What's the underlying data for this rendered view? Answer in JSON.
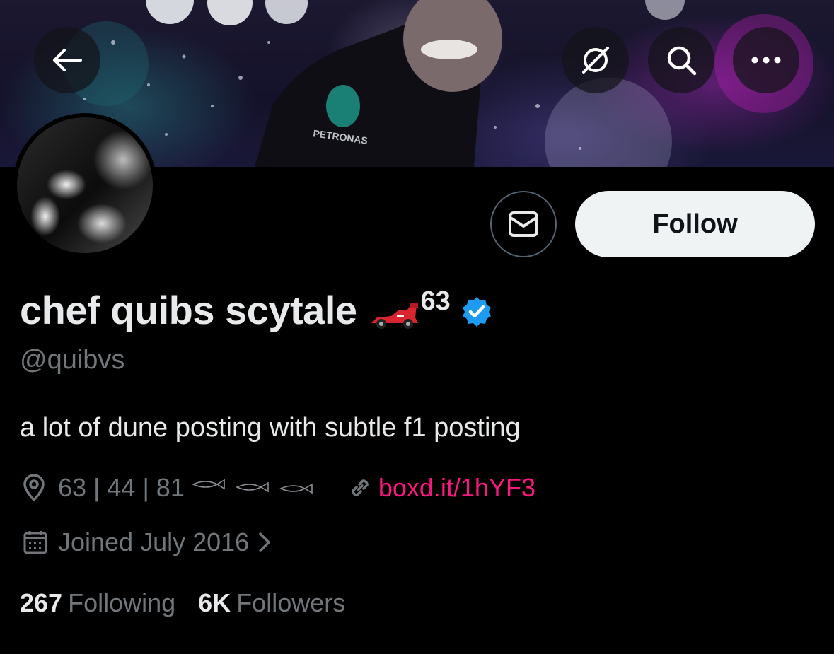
{
  "header": {
    "back_icon": "arrow-left-icon",
    "actions": [
      "grok-icon",
      "search-icon",
      "more-icon"
    ]
  },
  "profile": {
    "name": "chef quibs scytale",
    "name_emoji": "racing-car-emoji",
    "name_suffix": "63",
    "verified_color": "#1d9bf0",
    "handle": "@quibvs",
    "bio": "a lot of dune posting with subtle f1 posting",
    "location": "63 | 44 | 81",
    "location_emoji": "fish-emoji",
    "link": "boxd.it/1hYF3",
    "joined": "Joined July 2016",
    "following_count": "267",
    "following_label": "Following",
    "followers_count": "6K",
    "followers_label": "Followers"
  },
  "actions": {
    "follow_label": "Follow",
    "message_icon": "envelope-icon"
  },
  "colors": {
    "link": "#f91880",
    "muted": "#71767b",
    "text": "#e7e9ea",
    "background": "#000000"
  }
}
